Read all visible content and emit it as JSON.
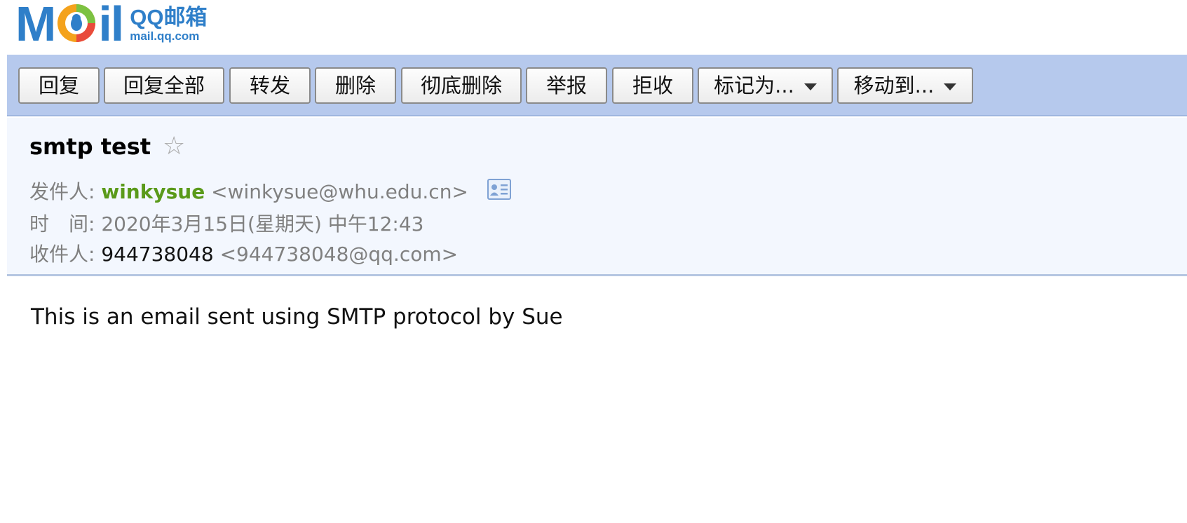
{
  "logo": {
    "mail_left": "M",
    "mail_right": "il",
    "brand": "QQ邮箱",
    "url": "mail.qq.com"
  },
  "toolbar": {
    "reply": "回复",
    "reply_all": "回复全部",
    "forward": "转发",
    "delete": "删除",
    "delete_permanently": "彻底删除",
    "report": "举报",
    "reject": "拒收",
    "mark_as": "标记为...",
    "move_to": "移动到..."
  },
  "email": {
    "subject": "smtp test",
    "star": "☆",
    "from_label": "发件人:",
    "from_name": "winkysue",
    "from_address": "<winkysue@whu.edu.cn>",
    "time_label": "时　间:",
    "time_value": "2020年3月15日(星期天) 中午12:43",
    "to_label": "收件人:",
    "to_name": "944738048",
    "to_address": "<944738048@qq.com>",
    "body": "This is an email sent using SMTP protocol by Sue"
  },
  "icons": [
    "qq-penguin-logo-icon",
    "star-icon",
    "contact-card-icon",
    "caret-down-icon"
  ]
}
